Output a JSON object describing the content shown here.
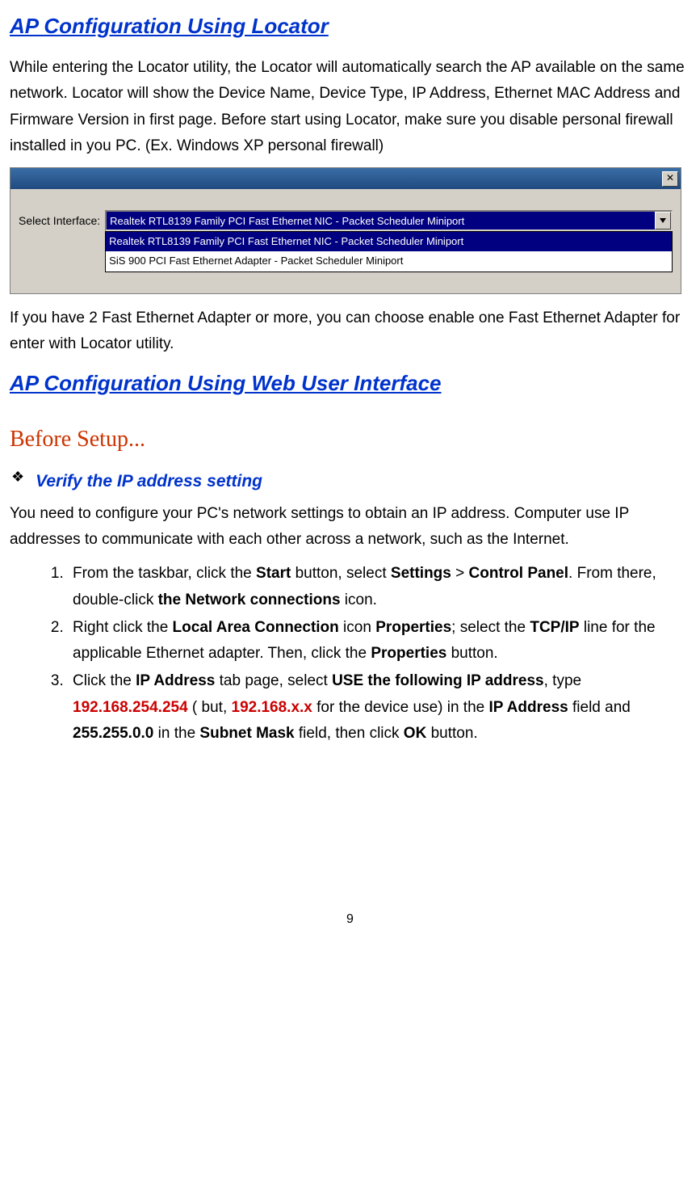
{
  "heading1": "AP Configuration Using Locator",
  "para1": "While entering the Locator utility, the Locator will automatically search the AP available on the same network. Locator will show the Device Name, Device Type, IP Address, Ethernet MAC Address and Firmware Version in first page. Before start using Locator, make sure you disable personal firewall installed in you PC. (Ex. Windows XP personal firewall)",
  "dialog": {
    "close_label": "✕",
    "label": "Select Interface:",
    "selected": "Realtek RTL8139 Family PCI Fast Ethernet NIC - Packet Scheduler Miniport",
    "options": [
      "Realtek RTL8139 Family PCI Fast Ethernet NIC - Packet Scheduler Miniport",
      "SiS 900 PCI Fast Ethernet Adapter - Packet Scheduler Miniport"
    ]
  },
  "para2": "If you have 2 Fast Ethernet Adapter or more, you can choose enable one Fast Ethernet Adapter for enter with Locator utility.",
  "heading2": "AP Configuration Using Web User Interface",
  "before_setup": "Before Setup...",
  "bullet_sym": "❖",
  "bullet_label": "Verify the IP address setting",
  "para3": "You need to configure your PC's network settings to obtain an IP address. Computer use IP addresses to communicate with each other across a network, such as the Internet.",
  "steps": {
    "s1": {
      "t1": "From the taskbar, click the ",
      "b1": "Start",
      "t2": " button, select ",
      "b2": "Settings",
      "t3": " > ",
      "b3": "Control Panel",
      "t4": ". From there, double-click ",
      "b4": "the Network connections",
      "t5": " icon."
    },
    "s2": {
      "t1": "Right click the ",
      "b1": "Local Area Connection",
      "t2": " icon ",
      "b2": "Properties",
      "t3": "; select the ",
      "b3": "TCP/IP",
      "t4": " line for the applicable Ethernet adapter. Then, click the ",
      "b4": "Properties",
      "t5": " button."
    },
    "s3": {
      "t1": "Click the ",
      "b1": "IP Address",
      "t2": " tab page, select ",
      "b2": "USE the following IP address",
      "t3": ", type ",
      "r1": "192.168.254.254",
      "t4": " ( but, ",
      "r2": "192.168.x.x",
      "t5": " for the device use) in the ",
      "b3": "IP Address",
      "t6": " field and ",
      "b4": "255.255.0.0",
      "t7": " in the ",
      "b5": "Subnet Mask",
      "t8": " field, then click ",
      "b6": "OK",
      "t9": " button."
    }
  },
  "page_number": "9"
}
